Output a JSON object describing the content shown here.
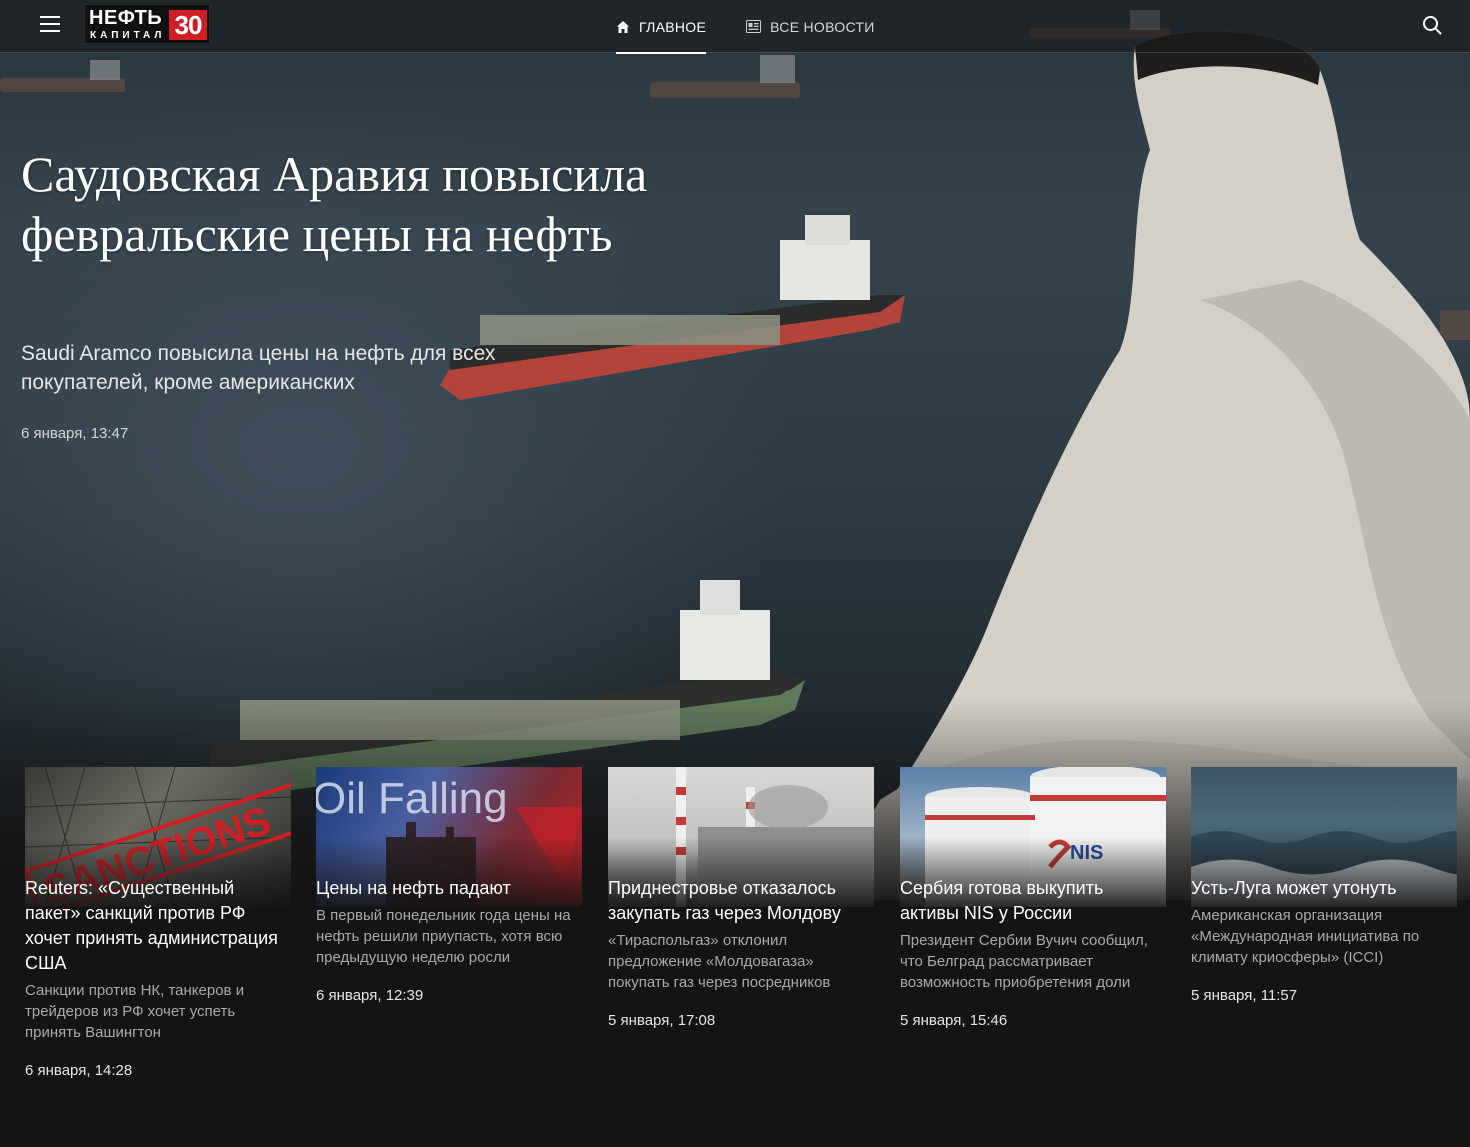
{
  "header": {
    "logo": {
      "top": "НЕФТЬ",
      "bottom": "КАПИТАЛ",
      "badge": "30"
    },
    "nav": [
      {
        "label": "ГЛАВНОЕ",
        "icon": "home-icon",
        "active": true
      },
      {
        "label": "ВСЕ НОВОСТИ",
        "icon": "newspaper-icon",
        "active": false
      }
    ]
  },
  "hero": {
    "title": "Саудовская Аравия повысила февральские цены на нефть",
    "subtitle": "Saudi Aramco повысила цены на нефть для всех покупателей, кроме американских",
    "date": "6 января, 13:47"
  },
  "cards": [
    {
      "title": "Reuters: «Существенный пакет» санкций против РФ хочет принять администрация США",
      "desc": "Санкции против НК, танкеров и трейдеров из РФ хочет успеть принять Вашингтон",
      "date": "6 января, 14:28",
      "image_text": "SANCTIONS"
    },
    {
      "title": "Цены на нефть падают",
      "desc": "В первый понедельник года цены на нефть решили приупасть, хотя всю предыдущую неделю росли",
      "date": "6 января, 12:39",
      "image_text": "Oil Falling"
    },
    {
      "title": "Приднестровье отказалось закупать газ через Молдову",
      "desc": "«Тираспольгаз» отклонил предложение «Молдовагаза» покупать газ через посредников",
      "date": "5 января, 17:08"
    },
    {
      "title": "Сербия готова выкупить активы NIS у России",
      "desc": "Президент Сербии Вучич сообщил, что Белград рассматривает возможность приобретения доли",
      "date": "5 января, 15:46",
      "image_text": "NIS"
    },
    {
      "title": "Усть-Луга может утонуть",
      "desc": "Американская организация «Международная инициатива по климату криосферы» (ICCI)",
      "date": "5 января, 11:57"
    }
  ]
}
